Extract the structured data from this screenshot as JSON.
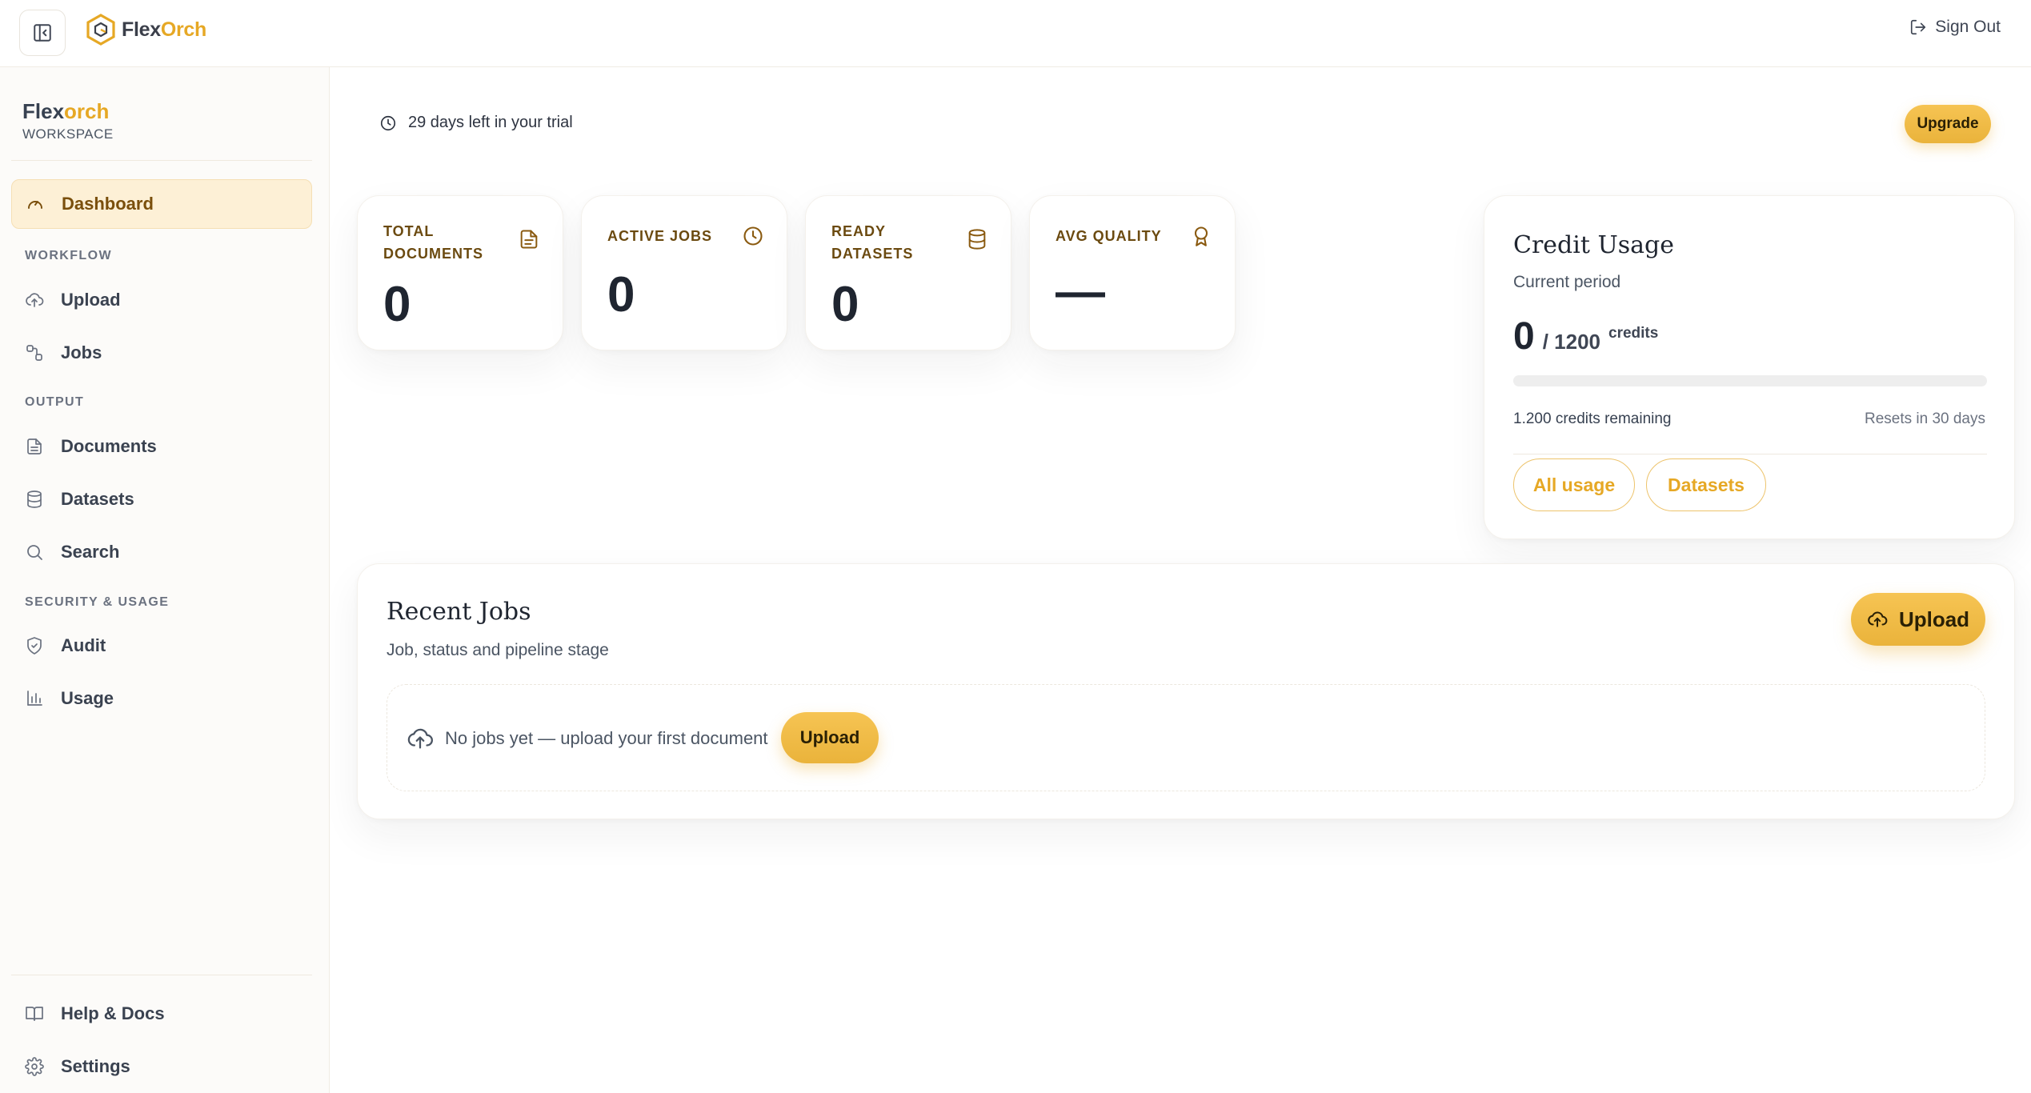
{
  "brand": {
    "part1": "Flex",
    "part2": "Orch"
  },
  "header": {
    "sign_out": "Sign Out"
  },
  "workspace": {
    "part1": "Flex",
    "part2": "orch",
    "subtitle": "WORKSPACE"
  },
  "sidebar": {
    "dashboard": "Dashboard",
    "section_workflow": "WORKFLOW",
    "upload": "Upload",
    "jobs": "Jobs",
    "section_output": "OUTPUT",
    "documents": "Documents",
    "datasets": "Datasets",
    "search": "Search",
    "section_security": "SECURITY & USAGE",
    "audit": "Audit",
    "usage": "Usage",
    "help": "Help & Docs",
    "settings": "Settings"
  },
  "trial": {
    "text": "29 days left in your trial",
    "upgrade": "Upgrade"
  },
  "stats": [
    {
      "label": "TOTAL DOCUMENTS",
      "value": "0",
      "icon": "document-icon"
    },
    {
      "label": "ACTIVE JOBS",
      "value": "0",
      "icon": "clock-icon"
    },
    {
      "label": "READY DATASETS",
      "value": "0",
      "icon": "database-icon"
    },
    {
      "label": "AVG QUALITY",
      "value": "—",
      "icon": "award-icon"
    }
  ],
  "credit": {
    "title": "Credit Usage",
    "subtitle": "Current period",
    "used": "0",
    "total": "/ 1200",
    "unit": "credits",
    "used_fraction": 0,
    "remaining": "1.200 credits remaining",
    "resets": "Resets in 30 days",
    "all_usage": "All usage",
    "datasets": "Datasets"
  },
  "jobs": {
    "title": "Recent Jobs",
    "subtitle": "Job, status and pipeline stage",
    "upload": "Upload",
    "empty_text": "No jobs yet — upload your first document",
    "empty_upload": "Upload"
  },
  "colors": {
    "accent": "#eab33b",
    "accent_text": "#e6a825",
    "active_bg": "#fdf0d6",
    "label_brown": "#6b4a10"
  }
}
